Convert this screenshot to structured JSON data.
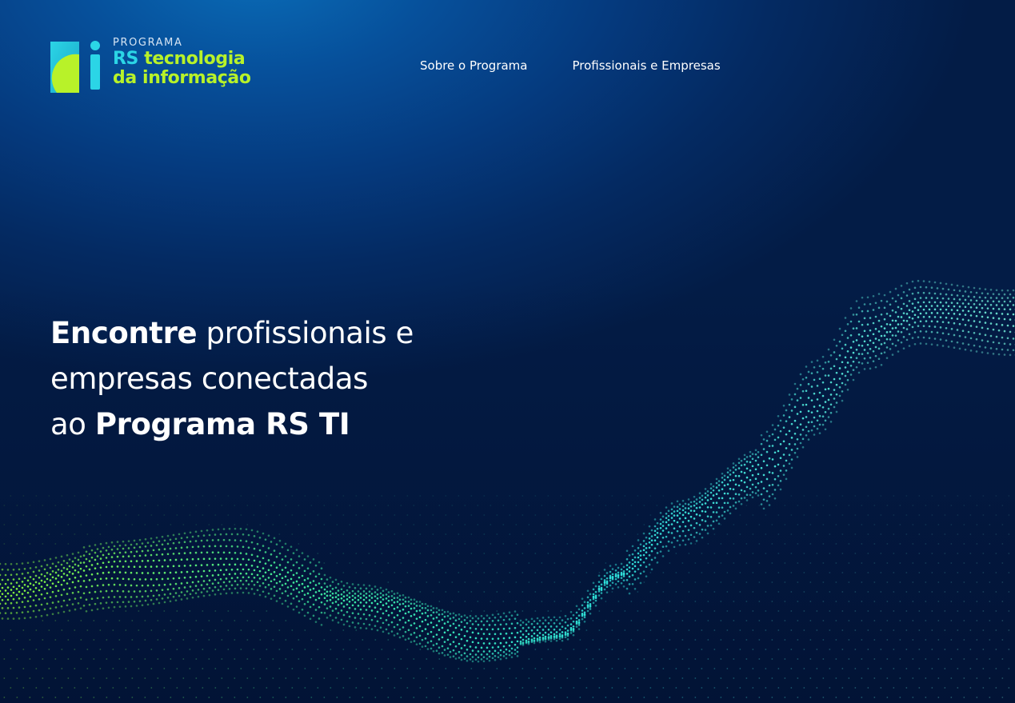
{
  "logo": {
    "program_label": "PROGRAMA",
    "line1_accent": "RS",
    "line1_rest": "tecnologia",
    "line2": "da informação",
    "mark_letter": "ti"
  },
  "nav": {
    "items": [
      {
        "label": "Sobre o Programa"
      },
      {
        "label": "Profissionais e Empresas"
      }
    ]
  },
  "hero": {
    "line1_bold": "Encontre",
    "line1_rest": " profissionais e",
    "line2": "empresas conectadas",
    "line3_pre": "ao ",
    "line3_bold": "Programa RS TI"
  },
  "colors": {
    "background_top": "#0a6db8",
    "background_bottom": "#031c46",
    "brand_green": "#b8f229",
    "brand_cyan": "#2bd5e6",
    "wave_green": "#7dff3a",
    "wave_cyan": "#2fe6e0"
  }
}
